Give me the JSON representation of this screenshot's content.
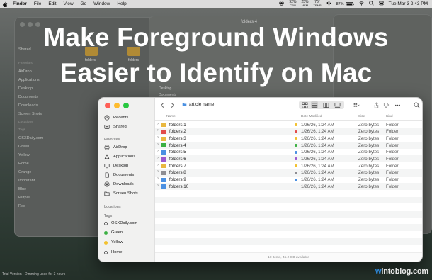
{
  "menubar": {
    "app": "Finder",
    "menus": [
      "File",
      "Edit",
      "View",
      "Go",
      "Window",
      "Help"
    ],
    "stats": [
      {
        "value": "92%",
        "label": "CPU"
      },
      {
        "value": "25%",
        "label": "MEM"
      },
      {
        "value": "76°",
        "label": "TEMP"
      }
    ],
    "battery": "87%",
    "clock": "Tue Mar 3  2:43 PM"
  },
  "headline": {
    "line1": "Make Foreground Windows",
    "line2": "Easier to Identify on Mac"
  },
  "background": {
    "window_title": "folders 4",
    "folder_labels": [
      "folders",
      "folders"
    ],
    "sidebar": {
      "items_top": [
        "Shared"
      ],
      "favorites_label": "Favorites",
      "favorites": [
        "AirDrop",
        "Applications",
        "Desktop",
        "Documents",
        "Downloads",
        "Screen Shots"
      ],
      "locations_label": "Locations",
      "tags_label": "Tags",
      "tags": [
        "OSXDaily.com",
        "Green",
        "Yellow",
        "Home",
        "Orange",
        "Important",
        "Blue",
        "Purple",
        "Red"
      ]
    },
    "right_sidebar": [
      "Desktop",
      "Documents"
    ]
  },
  "finder": {
    "path_title": "article name",
    "columns": {
      "name": "Name",
      "date": "Date Modified",
      "size": "Size",
      "kind": "Kind"
    },
    "sidebar": {
      "recents": "Recents",
      "shared": "Shared",
      "favorites_label": "Favorites",
      "favorites": [
        "AirDrop",
        "Applications",
        "Desktop",
        "Documents",
        "Downloads",
        "Screen Shots"
      ],
      "locations_label": "Locations",
      "tags_label": "Tags",
      "tags": [
        {
          "name": "OSXDaily.com",
          "color": "#ffffff"
        },
        {
          "name": "Green",
          "color": "#3cb043"
        },
        {
          "name": "Yellow",
          "color": "#f2c12e"
        },
        {
          "name": "Home",
          "color": "#ffffff"
        }
      ]
    },
    "rows": [
      {
        "name": "folders 1",
        "date": "1/26/26, 1:24 AM",
        "size": "Zero bytes",
        "kind": "Folder",
        "folder_color": "#e9b841",
        "tag_color": "#f2c12e"
      },
      {
        "name": "folders 2",
        "date": "1/26/26, 1:24 AM",
        "size": "Zero bytes",
        "kind": "Folder",
        "folder_color": "#e24c4b",
        "tag_color": "#e24c4b"
      },
      {
        "name": "folders 3",
        "date": "1/26/26, 1:24 AM",
        "size": "Zero bytes",
        "kind": "Folder",
        "folder_color": "#e9b841",
        "tag_color": "#f2c12e"
      },
      {
        "name": "folders 4",
        "date": "1/26/26, 1:24 AM",
        "size": "Zero bytes",
        "kind": "Folder",
        "folder_color": "#3cb043",
        "tag_color": "#3cb043"
      },
      {
        "name": "folders 5",
        "date": "1/26/26, 1:24 AM",
        "size": "Zero bytes",
        "kind": "Folder",
        "folder_color": "#4a90e2",
        "tag_color": "#4a90e2"
      },
      {
        "name": "folders 6",
        "date": "1/26/26, 1:24 AM",
        "size": "Zero bytes",
        "kind": "Folder",
        "folder_color": "#9b59d0",
        "tag_color": "#9b59d0"
      },
      {
        "name": "folders 7",
        "date": "1/26/26, 1:24 AM",
        "size": "Zero bytes",
        "kind": "Folder",
        "folder_color": "#e9b841",
        "tag_color": "#f2c12e"
      },
      {
        "name": "folders 8",
        "date": "1/26/26, 1:24 AM",
        "size": "Zero bytes",
        "kind": "Folder",
        "folder_color": "#8e8e93",
        "tag_color": "#8e8e93"
      },
      {
        "name": "folders 9",
        "date": "1/26/26, 1:24 AM",
        "size": "Zero bytes",
        "kind": "Folder",
        "folder_color": "#4a90e2",
        "tag_color": "#4a90e2"
      },
      {
        "name": "folders 10",
        "date": "1/26/26, 1:24 AM",
        "size": "Zero bytes",
        "kind": "Folder",
        "folder_color": "#4a90e2",
        "tag_color": ""
      }
    ],
    "status": "10 items, 45.2 GB available"
  },
  "footer": {
    "trial_note": "Trial Version - Dimming used for 3 hours",
    "watermark_prefix": "",
    "watermark_w": "w",
    "watermark_rest": "intoblog.com"
  }
}
